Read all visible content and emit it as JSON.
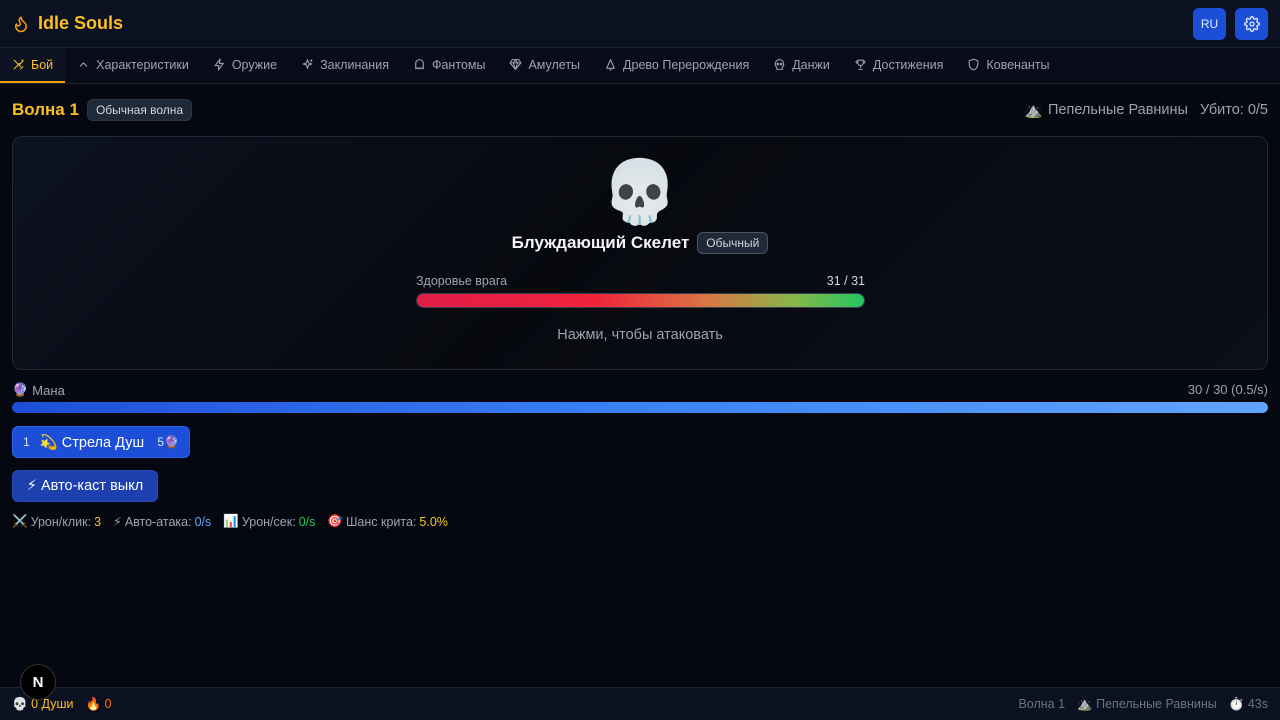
{
  "app": {
    "title": "Idle Souls"
  },
  "header": {
    "lang_label": "RU"
  },
  "tabs": [
    {
      "label": "Бой",
      "icon": "crossed-swords-icon"
    },
    {
      "label": "Характеристики",
      "icon": "chevron-up-icon"
    },
    {
      "label": "Оружие",
      "icon": "lightning-icon"
    },
    {
      "label": "Заклинания",
      "icon": "sparkles-icon"
    },
    {
      "label": "Фантомы",
      "icon": "ghost-icon"
    },
    {
      "label": "Амулеты",
      "icon": "gem-icon"
    },
    {
      "label": "Древо Перерождения",
      "icon": "bell-icon"
    },
    {
      "label": "Данжи",
      "icon": "skull-icon"
    },
    {
      "label": "Достижения",
      "icon": "trophy-icon"
    },
    {
      "label": "Ковенанты",
      "icon": "shield-icon"
    }
  ],
  "wave": {
    "title": "Волна 1",
    "type": "Обычная волна",
    "location": "Пепельные Равнины",
    "kills": "Убито: 0/5"
  },
  "enemy": {
    "emoji": "💀",
    "name": "Блуждающий Скелет",
    "rarity": "Обычный",
    "hp_label": "Здоровье врага",
    "hp_text": "31 / 31",
    "hp_fraction": 1.0,
    "hint": "Нажми, чтобы атаковать"
  },
  "mana": {
    "label": "Мана",
    "value_text": "30 / 30 (0.5/s)",
    "fraction": 1.0
  },
  "spell": {
    "key": "1",
    "name": "💫 Стрела Душ",
    "cost": "5🔮"
  },
  "autocast": {
    "label": "⚡ Авто-каст выкл"
  },
  "stats": {
    "damage_click_label": "Урон/клик:",
    "damage_click_value": "3",
    "auto_attack_label": "Авто-атака:",
    "auto_attack_value": "0/s",
    "dps_label": "Урон/сек:",
    "dps_value": "0/s",
    "crit_label": "Шанс крита:",
    "crit_value": "5.0%"
  },
  "footer": {
    "souls": "0 Души",
    "embers": "0",
    "wave": "Волна 1",
    "location": "Пепельные Равнины",
    "timer": "43s"
  },
  "colors": {
    "accent": "#fbbf24",
    "primary_button": "#1d4ed8",
    "background": "#050811"
  }
}
